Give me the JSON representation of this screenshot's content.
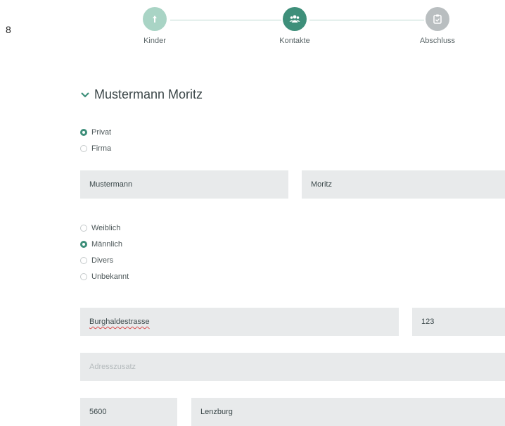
{
  "edge_number": "8",
  "stepper": {
    "steps": [
      {
        "label": "Kinder",
        "state": "done",
        "icon": "child-icon"
      },
      {
        "label": "Kontakte",
        "state": "active",
        "icon": "group-icon"
      },
      {
        "label": "Abschluss",
        "state": "todo",
        "icon": "clipboard-icon"
      }
    ],
    "colors": {
      "done": "#a9d4c5",
      "active": "#3e8f7a",
      "todo": "#b9bec0",
      "line": "#bcd9d1"
    }
  },
  "contact": {
    "title": "Mustermann Moritz",
    "type_options": [
      {
        "label": "Privat",
        "checked": true
      },
      {
        "label": "Firma",
        "checked": false
      }
    ],
    "last_name": "Mustermann",
    "first_name": "Moritz",
    "gender_options": [
      {
        "label": "Weiblich",
        "checked": false
      },
      {
        "label": "Männlich",
        "checked": true
      },
      {
        "label": "Divers",
        "checked": false
      },
      {
        "label": "Unbekannt",
        "checked": false
      }
    ],
    "street": "Burghaldestrasse",
    "house_number": "123",
    "address_extra_placeholder": "Adresszusatz",
    "zip": "5600",
    "city": "Lenzburg"
  },
  "accent_color": "#3e8f7a"
}
